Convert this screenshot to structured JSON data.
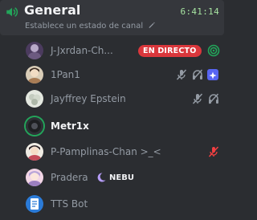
{
  "channel": {
    "name": "General",
    "timer": "6:41:14",
    "status": "Establece un estado de canal",
    "icon": "speaker-icon"
  },
  "users": [
    {
      "name": "J-Jxrdan-Ch...",
      "badge": "EN DIRECTO",
      "icons": [
        "stream-icon"
      ]
    },
    {
      "name": "1Pan1",
      "icons": [
        "mic-muted-icon",
        "headset-deafened-icon",
        "activity-icon"
      ]
    },
    {
      "name": "Jayffrey Epstein",
      "icons": [
        "mic-muted-icon",
        "headset-deafened-icon"
      ]
    },
    {
      "name": "Metr1x",
      "speaking": true,
      "icons": []
    },
    {
      "name": "P-Pamplinas-Chan >_<",
      "icons": [
        "server-muted-mic-icon"
      ]
    },
    {
      "name": "Pradera",
      "tag": "NEBU",
      "icons": [
        "nebu-moon-icon"
      ]
    },
    {
      "name": "TTS Bot",
      "icons": []
    }
  ],
  "colors": {
    "background": "#2b2d31",
    "header": "#35373c",
    "live": "#da373c",
    "speaking": "#23a55a",
    "muted": "#949ba4",
    "server_muted": "#f23f42",
    "activity": "#5865f2"
  }
}
